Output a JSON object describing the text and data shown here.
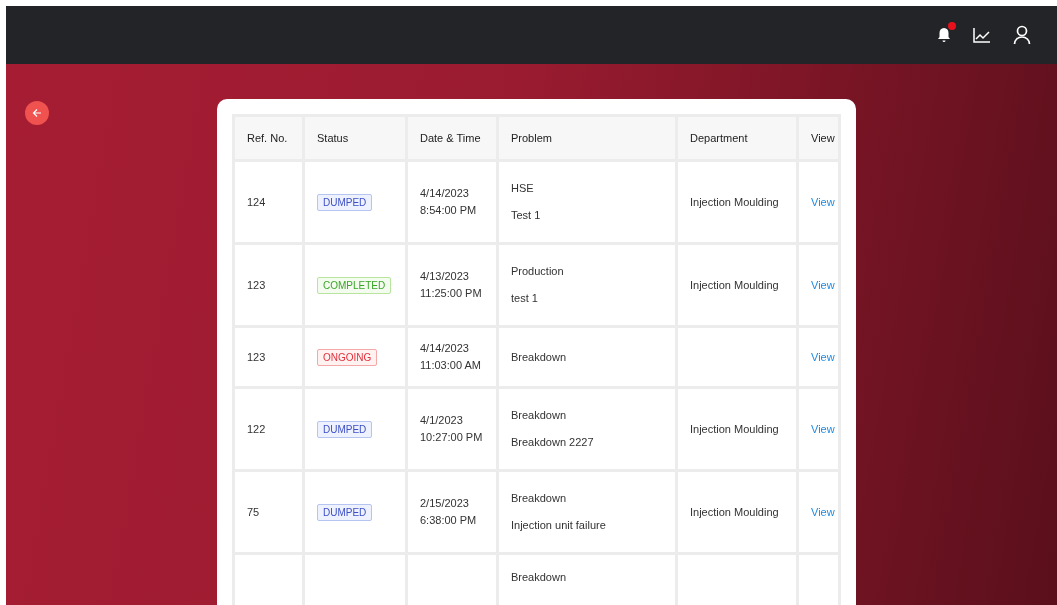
{
  "table": {
    "columns": [
      "Ref. No.",
      "Status",
      "Date & Time",
      "Problem",
      "Department",
      "View"
    ],
    "rows": [
      {
        "ref": "124",
        "status": {
          "label": "DUMPED",
          "kind": "dumped"
        },
        "date": "4/14/2023",
        "time": "8:54:00 PM",
        "problem": "HSE",
        "detail": "Test 1",
        "department": "Injection Moulding",
        "link": "View"
      },
      {
        "ref": "123",
        "status": {
          "label": "COMPLETED",
          "kind": "completed"
        },
        "date": "4/13/2023",
        "time": "11:25:00 PM",
        "problem": "Production",
        "detail": "test 1",
        "department": "Injection Moulding",
        "link": "View"
      },
      {
        "ref": "123",
        "status": {
          "label": "ONGOING",
          "kind": "ongoing"
        },
        "date": "4/14/2023",
        "time": "11:03:00 AM",
        "problem": "Breakdown",
        "link": "View"
      },
      {
        "ref": "122",
        "status": {
          "label": "DUMPED",
          "kind": "dumped"
        },
        "date": "4/1/2023",
        "time": "10:27:00 PM",
        "problem": "Breakdown",
        "detail": "Breakdown 2227",
        "department": "Injection Moulding",
        "link": "View"
      },
      {
        "ref": "75",
        "status": {
          "label": "DUMPED",
          "kind": "dumped"
        },
        "date": "2/15/2023",
        "time": "6:38:00 PM",
        "problem": "Breakdown",
        "detail": "Injection unit failure",
        "department": "Injection Moulding",
        "link": "View"
      },
      {
        "problem": "Breakdown"
      }
    ]
  }
}
